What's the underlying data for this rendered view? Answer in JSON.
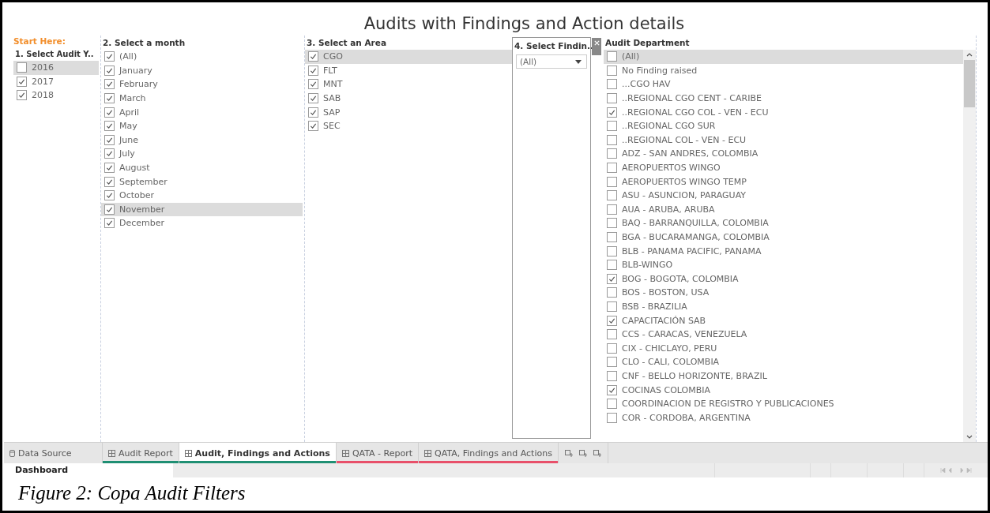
{
  "dashboard": {
    "title": "Audits with Findings and Action details"
  },
  "year_filter": {
    "hint": "Start Here:",
    "title": "1. Select Audit Y..",
    "items": [
      {
        "label": "2016",
        "checked": false,
        "selected": true
      },
      {
        "label": "2017",
        "checked": true,
        "selected": false
      },
      {
        "label": "2018",
        "checked": true,
        "selected": false
      }
    ]
  },
  "month_filter": {
    "title": "2. Select a month",
    "items": [
      {
        "label": "(All)",
        "checked": true,
        "selected": false
      },
      {
        "label": "January",
        "checked": true,
        "selected": false
      },
      {
        "label": "February",
        "checked": true,
        "selected": false
      },
      {
        "label": "March",
        "checked": true,
        "selected": false
      },
      {
        "label": "April",
        "checked": true,
        "selected": false
      },
      {
        "label": "May",
        "checked": true,
        "selected": false
      },
      {
        "label": "June",
        "checked": true,
        "selected": false
      },
      {
        "label": "July",
        "checked": true,
        "selected": false
      },
      {
        "label": "August",
        "checked": true,
        "selected": false
      },
      {
        "label": "September",
        "checked": true,
        "selected": false
      },
      {
        "label": "October",
        "checked": true,
        "selected": false
      },
      {
        "label": "November",
        "checked": true,
        "selected": true
      },
      {
        "label": "December",
        "checked": true,
        "selected": false
      }
    ]
  },
  "area_filter": {
    "title": "3. Select an Area",
    "items": [
      {
        "label": "CGO",
        "checked": true,
        "selected": true
      },
      {
        "label": "FLT",
        "checked": true,
        "selected": false
      },
      {
        "label": "MNT",
        "checked": true,
        "selected": false
      },
      {
        "label": "SAB",
        "checked": true,
        "selected": false
      },
      {
        "label": "SAP",
        "checked": true,
        "selected": false
      },
      {
        "label": "SEC",
        "checked": true,
        "selected": false
      }
    ]
  },
  "finding_filter": {
    "title": "4. Select Findin..",
    "value": "(All)"
  },
  "department_filter": {
    "title": "Audit Department",
    "items": [
      {
        "label": "(All)",
        "checked": false,
        "selected": true
      },
      {
        "label": "No Finding raised",
        "checked": false,
        "selected": false
      },
      {
        "label": "...CGO HAV",
        "checked": false,
        "selected": false
      },
      {
        "label": "..REGIONAL CGO CENT - CARIBE",
        "checked": false,
        "selected": false
      },
      {
        "label": "..REGIONAL CGO COL - VEN - ECU",
        "checked": true,
        "selected": false
      },
      {
        "label": "..REGIONAL CGO SUR",
        "checked": false,
        "selected": false
      },
      {
        "label": "..REGIONAL COL - VEN - ECU",
        "checked": false,
        "selected": false
      },
      {
        "label": "ADZ - SAN ANDRES, COLOMBIA",
        "checked": false,
        "selected": false
      },
      {
        "label": "AEROPUERTOS WINGO",
        "checked": false,
        "selected": false
      },
      {
        "label": "AEROPUERTOS WINGO TEMP",
        "checked": false,
        "selected": false
      },
      {
        "label": "ASU - ASUNCION, PARAGUAY",
        "checked": false,
        "selected": false
      },
      {
        "label": "AUA - ARUBA, ARUBA",
        "checked": false,
        "selected": false
      },
      {
        "label": "BAQ - BARRANQUILLA, COLOMBIA",
        "checked": false,
        "selected": false
      },
      {
        "label": "BGA - BUCARAMANGA, COLOMBIA",
        "checked": false,
        "selected": false
      },
      {
        "label": "BLB - PANAMA PACIFIC, PANAMA",
        "checked": false,
        "selected": false
      },
      {
        "label": "BLB-WINGO",
        "checked": false,
        "selected": false
      },
      {
        "label": "BOG - BOGOTA, COLOMBIA",
        "checked": true,
        "selected": false
      },
      {
        "label": "BOS - BOSTON, USA",
        "checked": false,
        "selected": false
      },
      {
        "label": "BSB - BRAZILIA",
        "checked": false,
        "selected": false
      },
      {
        "label": "CAPACITACIÓN SAB",
        "checked": true,
        "selected": false
      },
      {
        "label": "CCS - CARACAS, VENEZUELA",
        "checked": false,
        "selected": false
      },
      {
        "label": "CIX - CHICLAYO, PERU",
        "checked": false,
        "selected": false
      },
      {
        "label": "CLO - CALI, COLOMBIA",
        "checked": false,
        "selected": false
      },
      {
        "label": "CNF - BELLO HORIZONTE, BRAZIL",
        "checked": false,
        "selected": false
      },
      {
        "label": "COCINAS COLOMBIA",
        "checked": true,
        "selected": false
      },
      {
        "label": "COORDINACION DE REGISTRO Y PUBLICACIONES",
        "checked": false,
        "selected": false
      },
      {
        "label": "COR - CORDOBA, ARGENTINA",
        "checked": false,
        "selected": false
      }
    ]
  },
  "sheet_tabs": [
    {
      "label": "Data Source",
      "kind": "source",
      "selected": false
    },
    {
      "label": "Audit Report",
      "kind": "sheet",
      "selected": false,
      "color": "#1f8f73"
    },
    {
      "label": "Audit, Findings and Actions",
      "kind": "sheet",
      "selected": true,
      "color": "#1f8f73"
    },
    {
      "label": "QATA - Report",
      "kind": "sheet",
      "selected": false,
      "color": "#e8506a"
    },
    {
      "label": "QATA, Findings and Actions",
      "kind": "sheet",
      "selected": false,
      "color": "#e8506a"
    }
  ],
  "status_bar": {
    "sheet_name": "Dashboard"
  },
  "caption": "Figure 2: Copa Audit Filters"
}
